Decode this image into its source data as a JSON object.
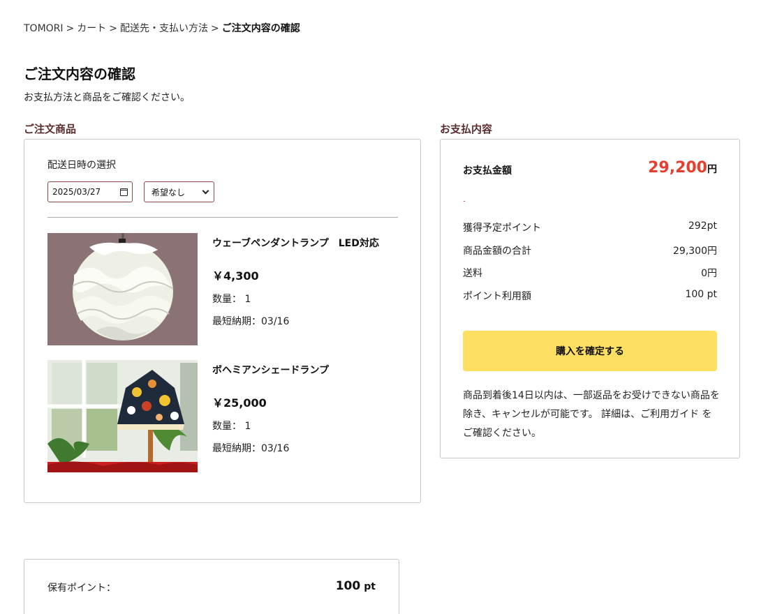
{
  "breadcrumb": {
    "items": [
      "TOMORI",
      "カート",
      "配送先・支払い方法"
    ],
    "current": "ご注文内容の確認",
    "separator": ">"
  },
  "page": {
    "title": "ご注文内容の確認",
    "subtitle": "お支払方法と商品をご確認ください。"
  },
  "order_items": {
    "heading": "ご注文商品",
    "delivery_label": "配送日時の選択",
    "date_value": "2025/03/27",
    "time_value": "希望なし",
    "products": [
      {
        "name": "ウェーブペンダントランプ　LED対応",
        "price": "￥4,300",
        "qty": "数量： 1",
        "earliest": "最短納期：03/16",
        "image": "white-wave-pendant-lamp"
      },
      {
        "name": "ボヘミアンシェードランプ",
        "price": "￥25,000",
        "qty": "数量： 1",
        "earliest": "最短納期：03/16",
        "image": "floral-shade-lamp"
      }
    ]
  },
  "payment": {
    "heading": "お支払内容",
    "total_label": "お支払金額",
    "total_amount": "29,200",
    "total_unit": "円",
    "rows": [
      {
        "label": "獲得予定ポイント",
        "value": "292pt"
      },
      {
        "label": "商品金額の合計",
        "value": "29,300円"
      },
      {
        "label": "送料",
        "value": "0円"
      },
      {
        "label": "ポイント利用額",
        "value": "100 pt"
      }
    ],
    "confirm_label": "購入を確定する",
    "note": "商品到着後14日以内は、一部返品をお受けできない商品を除き、キャンセルが可能です。 詳細は、ご利用ガイド をご確認ください。"
  },
  "points": {
    "label": "保有ポイント：",
    "value": "100",
    "unit": "pt"
  },
  "colors": {
    "accent_heading": "#5a2c2c",
    "total_red": "#e53e2e",
    "button_yellow": "#fddf62",
    "input_border": "#8b4a4a"
  }
}
